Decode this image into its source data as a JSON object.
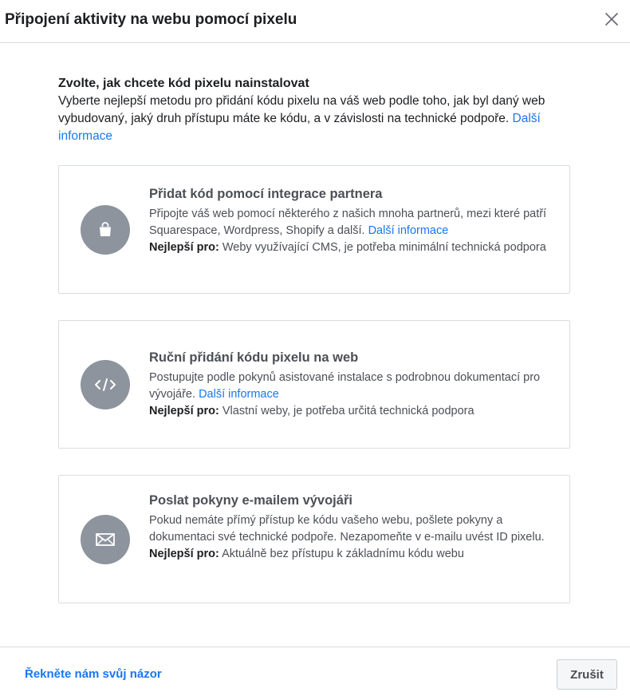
{
  "dialog": {
    "title": "Připojení aktivity na webu pomocí pixelu",
    "close_icon": "close-icon"
  },
  "intro": {
    "title": "Zvolte, jak chcete kód pixelu nainstalovat",
    "description": "Vyberte nejlepší metodu pro přidání kódu pixelu na váš web podle toho, jak byl daný web vybudovaný, jaký druh přístupu máte ke kódu, a v závislosti na technické podpoře.",
    "learn_more": "Další informace"
  },
  "options": [
    {
      "icon": "shopping-bag-icon",
      "title": "Přidat kód pomocí integrace partnera",
      "description": "Připojte váš web pomocí některého z našich mnoha partnerů, mezi které patří Squarespace, Wordpress, Shopify a další.",
      "learn_more": "Další informace",
      "best_for_label": "Nejlepší pro:",
      "best_for": "Weby využívající CMS, je potřeba minimální technická podpora"
    },
    {
      "icon": "code-icon",
      "title": "Ruční přidání kódu pixelu na web",
      "description": "Postupujte podle pokynů asistované instalace s podrobnou dokumentací pro vývojáře.",
      "learn_more": "Další informace",
      "best_for_label": "Nejlepší pro:",
      "best_for": "Vlastní weby, je potřeba určitá technická podpora"
    },
    {
      "icon": "envelope-icon",
      "title": "Poslat pokyny e-mailem vývojáři",
      "description": "Pokud nemáte přímý přístup ke kódu vašeho webu, pošlete pokyny a dokumentaci své technické podpoře. Nezapomeňte v e-mailu uvést ID pixelu.",
      "best_for_label": "Nejlepší pro:",
      "best_for": "Aktuálně bez přístupu k základnímu kódu webu"
    }
  ],
  "footer": {
    "feedback_link": "Řekněte nám svůj názor",
    "cancel_label": "Zrušit"
  },
  "colors": {
    "link": "#1877f2",
    "icon_circle": "#8d949e",
    "border": "#dadde1"
  }
}
